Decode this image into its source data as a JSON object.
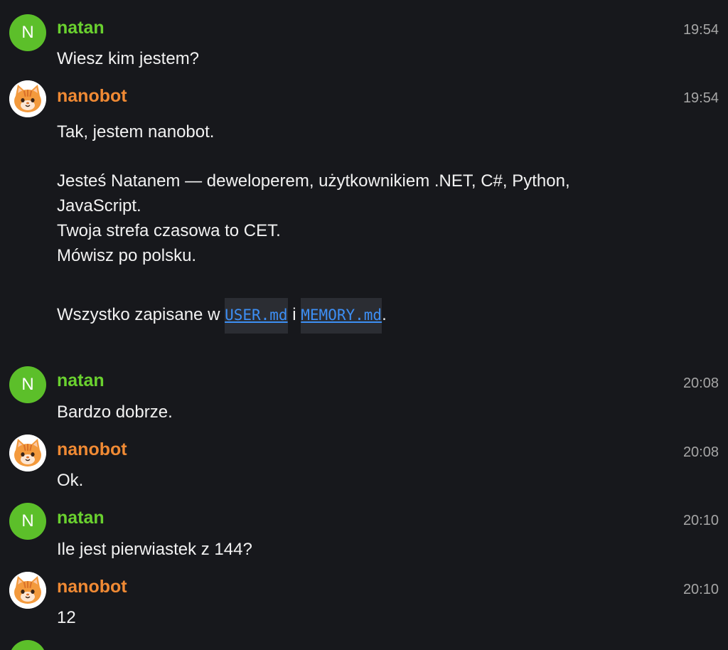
{
  "messages": [
    {
      "sender": "natan",
      "avatar_initial": "N",
      "time": "19:54",
      "text": "Wiesz kim jestem?"
    },
    {
      "sender": "nanobot",
      "avatar_icon": "cat-avatar-icon",
      "time": "19:54",
      "lines": [
        "Tak, jestem nanobot.",
        "Jesteś Natanem — deweloperem, użytkownikiem .NET, C#, Python,",
        "JavaScript.",
        "Twoja strefa czasowa to CET.",
        "Mówisz po polsku."
      ],
      "footer": {
        "prefix": "Wszystko zapisane w ",
        "file1": "USER.md",
        "joiner": " i ",
        "file2": "MEMORY.md",
        "suffix": "."
      }
    },
    {
      "sender": "natan",
      "avatar_initial": "N",
      "time": "20:08",
      "text": "Bardzo dobrze."
    },
    {
      "sender": "nanobot",
      "avatar_icon": "cat-avatar-icon",
      "time": "20:08",
      "text": "Ok."
    },
    {
      "sender": "natan",
      "avatar_initial": "N",
      "time": "20:10",
      "text": "Ile jest pierwiastek z 144?"
    },
    {
      "sender": "nanobot",
      "avatar_icon": "cat-avatar-icon",
      "time": "20:10",
      "text": "12"
    },
    {
      "sender": "",
      "avatar_initial": "",
      "time": "",
      "text": ""
    }
  ],
  "colors": {
    "background": "#17181c",
    "user_name": "#6ad12f",
    "user_avatar": "#5cbf2a",
    "bot_name": "#f08a34",
    "timestamp": "#a6a6a6",
    "code_text": "#3d8ff5",
    "code_background": "#2b2d33"
  }
}
